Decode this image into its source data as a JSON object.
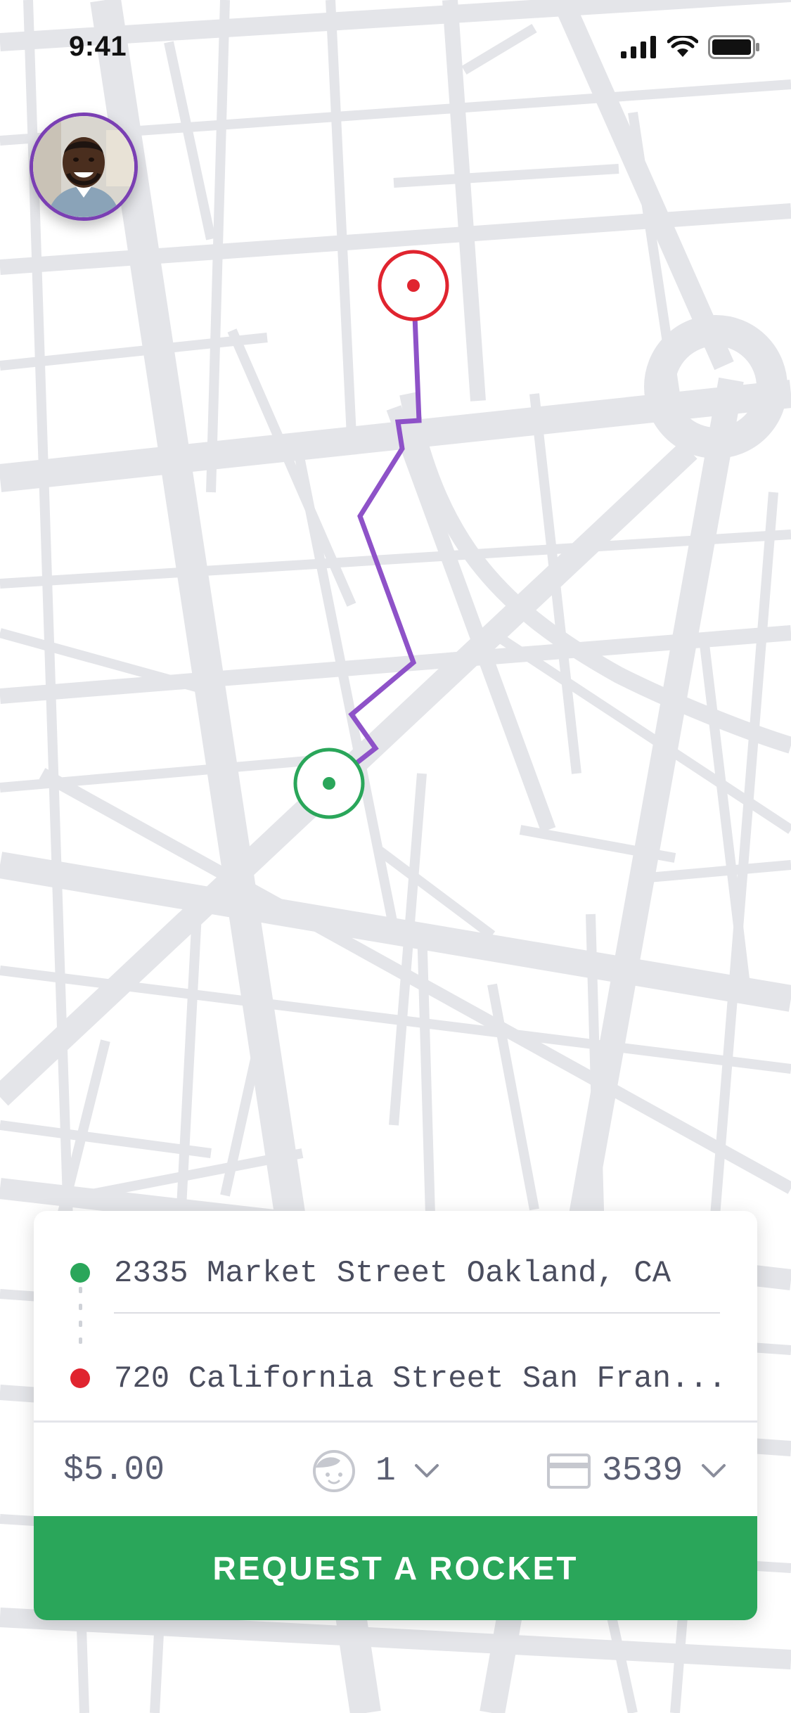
{
  "status_bar": {
    "time": "9:41"
  },
  "map": {
    "route_color": "#8e52c8",
    "pickup_pin_color": "#2aa65a",
    "dropoff_pin_color": "#e0242f",
    "road_color": "#e4e5e9"
  },
  "trip": {
    "pickup_address": "2335 Market Street Oakland, CA",
    "dropoff_address": "720 California Street San Fran..."
  },
  "options": {
    "price": "$5.00",
    "passenger_icon": "child-face-icon",
    "passenger_count": "1",
    "payment_icon": "credit-card-icon",
    "card_last_digits": "3539"
  },
  "actions": {
    "request_label": "REQUEST A ROCKET"
  },
  "colors": {
    "accent": "#2aa65a",
    "avatar_ring": "#7a3fb3",
    "text": "#4a4d5e"
  }
}
